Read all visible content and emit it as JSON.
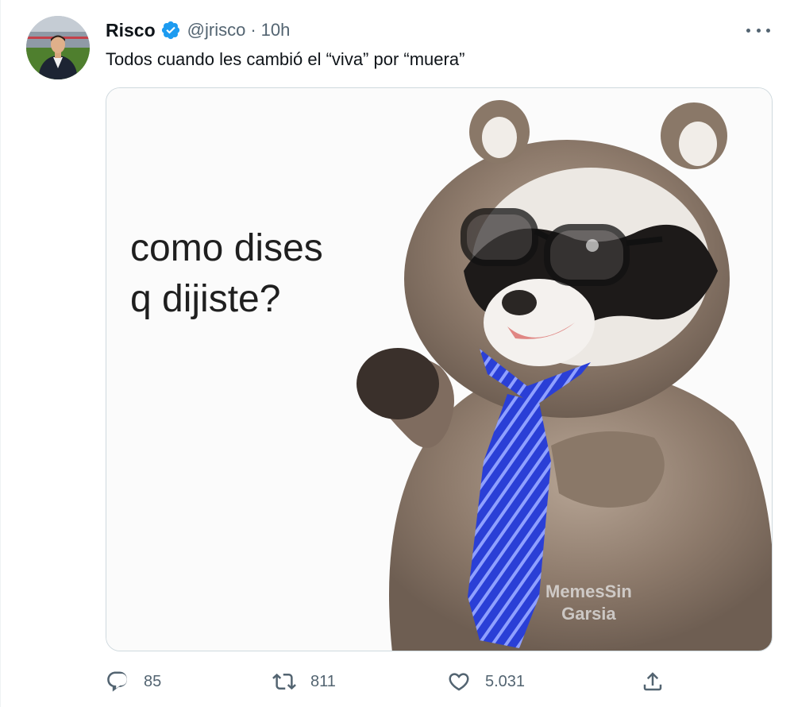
{
  "tweet": {
    "author": {
      "name": "Risco",
      "handle": "@jrisco",
      "separator": "·",
      "time": "10h",
      "verified_color": "#1d9bf0"
    },
    "text": "Todos cuando les cambió el “viva” por “muera”",
    "media": {
      "caption_line1": "como dises",
      "caption_line2": "q dijiste?",
      "watermark_line1": "MemesSin",
      "watermark_line2": "Garsia"
    },
    "stats": {
      "replies": "85",
      "retweets": "811",
      "likes": "5.031"
    },
    "icons": {
      "more": "more-options-icon",
      "reply": "reply-icon",
      "retweet": "retweet-icon",
      "like": "heart-icon",
      "share": "share-icon"
    },
    "colors": {
      "text_primary": "#0f1419",
      "text_secondary": "#536471",
      "border": "#cfd9de",
      "accent": "#1d9bf0"
    }
  }
}
